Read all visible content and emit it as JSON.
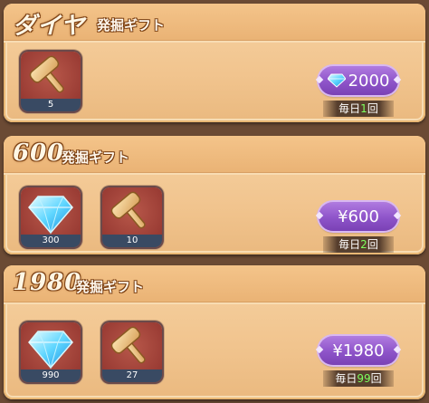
{
  "packs": [
    {
      "title": "ダイヤ",
      "subtitle": "発掘ギフト",
      "items": [
        {
          "icon": "hammer-icon",
          "qty": "5"
        }
      ],
      "price": "2000",
      "price_icon": "diamond-icon",
      "limit": {
        "prefix": "毎日",
        "count": "1",
        "suffix": "回"
      }
    },
    {
      "title": "600",
      "subtitle": "発掘ギフト",
      "items": [
        {
          "icon": "diamond-icon",
          "qty": "300"
        },
        {
          "icon": "hammer-icon",
          "qty": "10"
        }
      ],
      "price": "¥600",
      "limit": {
        "prefix": "毎日",
        "count": "2",
        "suffix": "回"
      }
    },
    {
      "title": "1980",
      "subtitle": "発掘ギフト",
      "items": [
        {
          "icon": "diamond-icon",
          "qty": "990"
        },
        {
          "icon": "hammer-icon",
          "qty": "27"
        }
      ],
      "price": "¥1980",
      "limit": {
        "prefix": "毎日",
        "count": "99",
        "suffix": "回"
      }
    }
  ],
  "colors": {
    "panel": "#f1c48e",
    "item_bg": "#9b3d35",
    "price_button": "#8e54c9",
    "limit_count": "#7dff5e"
  }
}
